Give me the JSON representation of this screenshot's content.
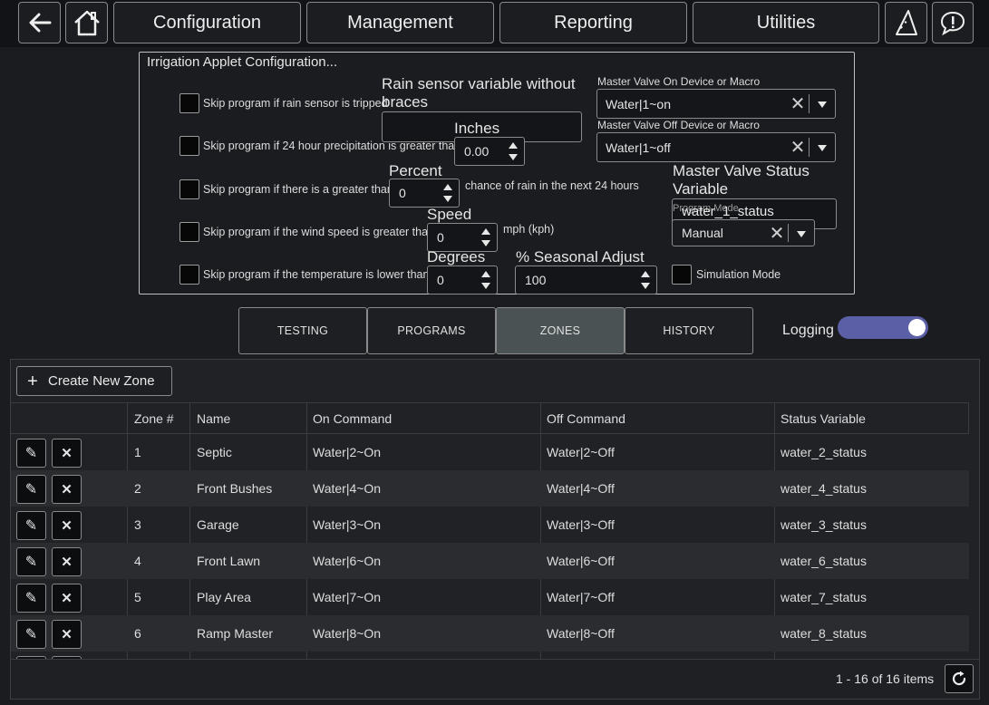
{
  "nav": {
    "back_icon": "arrow-left-icon",
    "home_icon": "home-icon",
    "tabs": [
      "Configuration",
      "Management",
      "Reporting",
      "Utilities"
    ],
    "wizard_icon": "wizard-hat-icon",
    "feedback_icon": "speech-bubble-exclamation-icon"
  },
  "config": {
    "title": "Irrigation Applet Configuration...",
    "skip_rain_sensor": "Skip program if rain sensor is tripped",
    "skip_precip": "Skip program if 24 hour precipitation is greater than",
    "skip_chance": "Skip program if there is a greater than",
    "skip_wind": "Skip program if the wind speed is greater than",
    "skip_temp": "Skip program if the temperature is lower than",
    "rain_sensor_label": "Rain sensor variable without braces",
    "rain_sensor_value": "",
    "inches_label": "Inches",
    "inches_value": "0.00",
    "percent_label": "Percent",
    "percent_value": "0",
    "chance_suffix": "chance of rain in the next 24 hours",
    "speed_label": "Speed",
    "speed_value": "0",
    "speed_suffix": "mph (kph)",
    "degrees_label": "Degrees",
    "degrees_value": "0",
    "seasonal_label": "% Seasonal Adjust",
    "seasonal_value": "100",
    "mv_on_label": "Master Valve On Device or Macro",
    "mv_on_value": "Water|1~on",
    "mv_off_label": "Master Valve Off Device or Macro",
    "mv_off_value": "Water|1~off",
    "mv_status_label": "Master Valve Status Variable",
    "mv_status_value": "water_1_status",
    "program_mode_label": "Program Mode",
    "program_mode_value": "Manual",
    "simulation_label": "Simulation Mode"
  },
  "tabs": {
    "items": [
      "TESTING",
      "PROGRAMS",
      "ZONES",
      "HISTORY"
    ],
    "active": "ZONES",
    "logging_label": "Logging",
    "logging_on": true
  },
  "grid": {
    "create_label": "Create New Zone",
    "columns": [
      "Zone #",
      "Name",
      "On Command",
      "Off Command",
      "Status Variable"
    ],
    "rows": [
      {
        "zone": "1",
        "name": "Septic",
        "on": "Water|2~On",
        "off": "Water|2~Off",
        "status": "water_2_status"
      },
      {
        "zone": "2",
        "name": "Front Bushes",
        "on": "Water|4~On",
        "off": "Water|4~Off",
        "status": "water_4_status"
      },
      {
        "zone": "3",
        "name": "Garage",
        "on": "Water|3~On",
        "off": "Water|3~Off",
        "status": "water_3_status"
      },
      {
        "zone": "4",
        "name": "Front Lawn",
        "on": "Water|6~On",
        "off": "Water|6~Off",
        "status": "water_6_status"
      },
      {
        "zone": "5",
        "name": "Play Area",
        "on": "Water|7~On",
        "off": "Water|7~Off",
        "status": "water_7_status"
      },
      {
        "zone": "6",
        "name": "Ramp Master",
        "on": "Water|8~On",
        "off": "Water|8~Off",
        "status": "water_8_status"
      }
    ],
    "pager": "1 - 16 of 16 items"
  },
  "colors": {
    "accent_toggle": "#5b5fa5",
    "background": "#1a1c20"
  }
}
